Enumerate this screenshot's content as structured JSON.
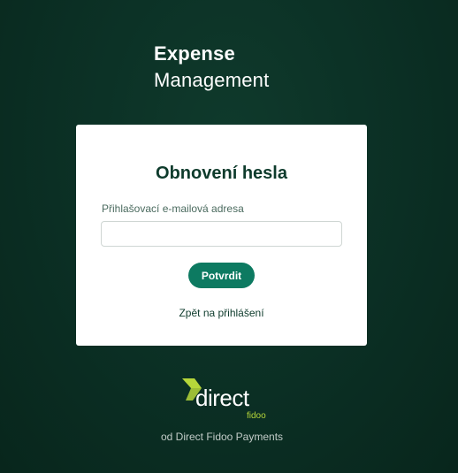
{
  "brand": {
    "line1": "Expense",
    "line2": "Management"
  },
  "card": {
    "title": "Obnovení hesla",
    "email_label": "Přihlašovací e-mailová adresa",
    "email_value": "",
    "email_placeholder": "",
    "submit_label": "Potvrdit",
    "back_link": "Zpět na přihlášení"
  },
  "logo": {
    "word": "direct",
    "sub": "fidoo",
    "icon": "direct-fidoo-logo-icon",
    "accent_color": "#b6d63a"
  },
  "footer": {
    "text": "od Direct Fidoo Payments"
  },
  "colors": {
    "background": "#0b2f24",
    "primary_button": "#0d7a61",
    "title_text": "#0e3b2c"
  }
}
